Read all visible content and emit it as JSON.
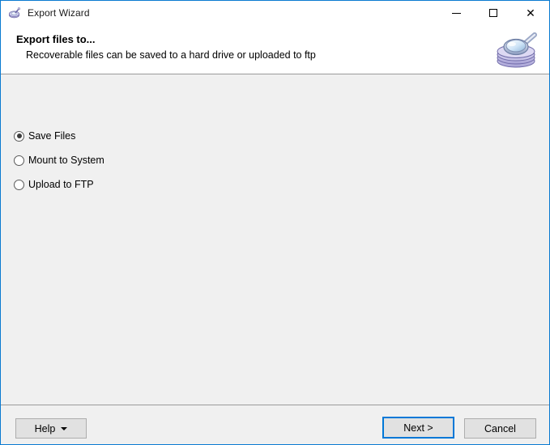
{
  "window": {
    "title": "Export Wizard",
    "app_icon": "disc-platter-icon",
    "border_color": "#0a7ad1",
    "controls": [
      {
        "name": "minimize",
        "glyph": "—"
      },
      {
        "name": "maximize",
        "glyph": "□"
      },
      {
        "name": "close",
        "glyph": "✕"
      }
    ]
  },
  "header": {
    "title": "Export files to...",
    "subtitle": "Recoverable files can be saved to a hard drive or uploaded to ftp",
    "icon": "magnifier-over-disc-platters-icon",
    "background": "#ffffff"
  },
  "content": {
    "background": "#f0f0f0",
    "options": [
      {
        "label": "Save Files",
        "selected": true
      },
      {
        "label": "Mount to System",
        "selected": false
      },
      {
        "label": "Upload to FTP",
        "selected": false
      }
    ]
  },
  "footer": {
    "help_label": "Help",
    "help_caret": "▼",
    "next_label": "Next >",
    "cancel_label": "Cancel",
    "default_button": "Next >",
    "focus_color": "#0078d7"
  }
}
